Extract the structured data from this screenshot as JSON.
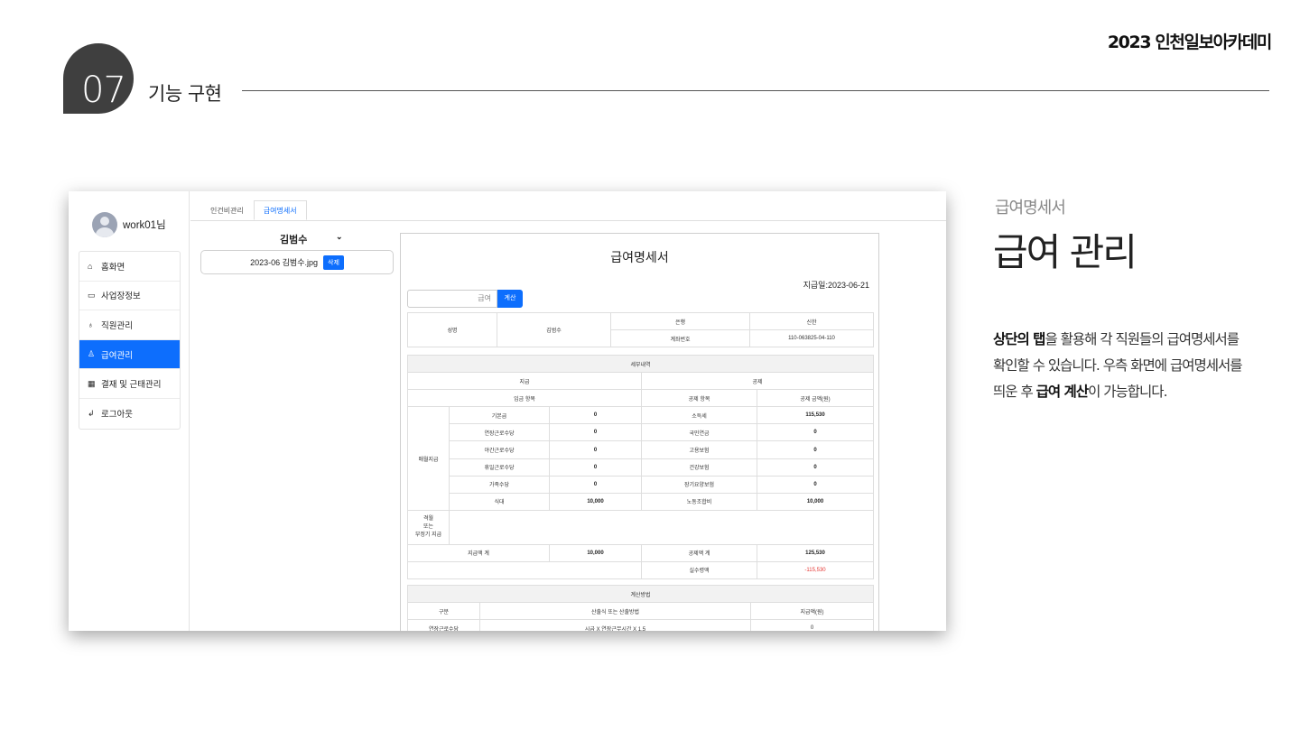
{
  "brand": "2023 인천일보아카데미",
  "section": {
    "number": "07",
    "title": "기능 구현"
  },
  "description": {
    "subtitle": "급여명세서",
    "title": "급여 관리",
    "line1_bold": "상단의 탭",
    "line1_rest": "을 활용해 각 직원들의 급여명세서를",
    "line2": "확인할 수 있습니다. 우측 화면에 급여명세서를",
    "line3_pre": "띄운 후 ",
    "line3_bold": "급여 계산",
    "line3_post": "이 가능합니다."
  },
  "app": {
    "user_name": "work01님",
    "menu": [
      {
        "icon": "home-icon",
        "glyph": "⌂",
        "label": "홈화면"
      },
      {
        "icon": "briefcase-icon",
        "glyph": "▭",
        "label": "사업장정보"
      },
      {
        "icon": "people-icon",
        "glyph": "♁",
        "label": "직원관리"
      },
      {
        "icon": "money-bag-icon",
        "glyph": "♙",
        "label": "급여관리",
        "active": true
      },
      {
        "icon": "calendar-icon",
        "glyph": "▦",
        "label": "결재 및 근태관리"
      },
      {
        "icon": "logout-icon",
        "glyph": "↲",
        "label": "로그아웃"
      }
    ],
    "tabs": [
      "인건비관리",
      "급여명세서"
    ],
    "active_tab": "급여명세서",
    "employee_select": "김범수",
    "file": {
      "name": "2023-06 김범수.jpg",
      "delete_label": "삭제"
    }
  },
  "payslip": {
    "title": "급여명세서",
    "pay_date": "지급일:2023-06-21",
    "pay_input_placeholder": "급여",
    "calc_button": "계산",
    "info": {
      "name_label": "성명",
      "name_value": "김범수",
      "bank_label": "은행",
      "bank_value": "신한",
      "account_label": "계좌번호",
      "account_value": "110-063825-04-110"
    },
    "section_title": "세부내역",
    "pay_header": "지급",
    "deduction_header": "공제",
    "pay_item_header": "임금 항목",
    "deduction_item_header": "공제 항목",
    "deduction_amount_header": "공제 금액(원)",
    "regular_label": "매월지급",
    "rows": [
      {
        "pay_item": "기본급",
        "pay_amount": "0",
        "ded_item": "소득세",
        "ded_amount": "115,530"
      },
      {
        "pay_item": "연장근로수당",
        "pay_amount": "0",
        "ded_item": "국민연금",
        "ded_amount": "0"
      },
      {
        "pay_item": "야간근로수당",
        "pay_amount": "0",
        "ded_item": "고용보험",
        "ded_amount": "0"
      },
      {
        "pay_item": "휴일근로수당",
        "pay_amount": "0",
        "ded_item": "건강보험",
        "ded_amount": "0"
      },
      {
        "pay_item": "가족수당",
        "pay_amount": "0",
        "ded_item": "장기요양보험",
        "ded_amount": "0"
      },
      {
        "pay_item": "식대",
        "pay_amount": "10,000",
        "ded_item": "노동조합비",
        "ded_amount": "10,000"
      }
    ],
    "irregular_label_1": "격월",
    "irregular_label_2": "또는",
    "irregular_label_3": "부정기 지급",
    "pay_total_label": "지급액 계",
    "pay_total": "10,000",
    "deduction_total_label": "공제액 계",
    "deduction_total": "125,530",
    "net_label": "실수령액",
    "net_value": "-115,530",
    "calc_section_title": "계산방법",
    "calc_headers": [
      "구분",
      "산출식 또는 산출방법",
      "지급액(원)"
    ],
    "calc_rows": [
      {
        "kind": "연장근로수당",
        "formula": "시급 X 연장근무시간 X 1.5",
        "amount": "0"
      }
    ]
  }
}
